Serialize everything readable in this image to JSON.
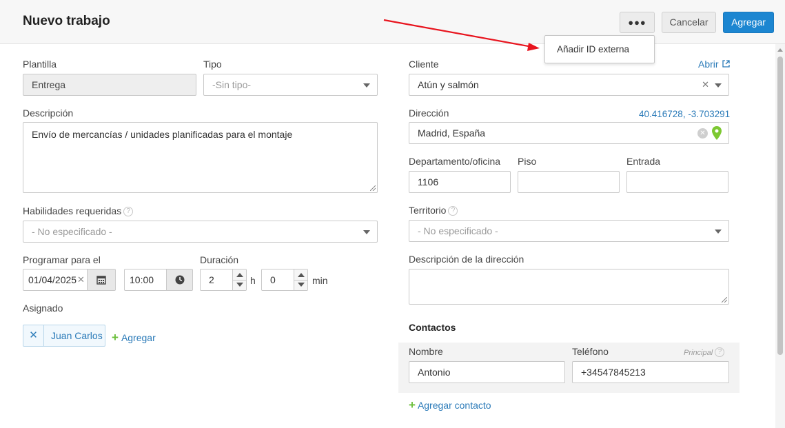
{
  "header": {
    "title": "Nuevo trabajo",
    "more_label": "●●●",
    "cancel_label": "Cancelar",
    "add_label": "Agregar"
  },
  "more_menu": {
    "items": [
      {
        "label": "Añadir ID externa"
      }
    ]
  },
  "form": {
    "plantilla": {
      "label": "Plantilla",
      "value": "Entrega"
    },
    "tipo": {
      "label": "Tipo",
      "placeholder": "-Sin tipo-"
    },
    "descripcion": {
      "label": "Descripción",
      "value": "Envío de mercancías / unidades planificadas para el montaje"
    },
    "habilidades": {
      "label": "Habilidades requeridas",
      "placeholder": "- No especificado -"
    },
    "programar": {
      "label": "Programar para el",
      "date": "01/04/2025",
      "time": "10:00"
    },
    "duracion": {
      "label": "Duración",
      "hours": "2",
      "hours_unit": "h",
      "minutes": "0",
      "minutes_unit": "min"
    },
    "asignado": {
      "label": "Asignado",
      "assignee": "Juan Carlos",
      "add_label": "Agregar"
    },
    "cliente": {
      "label": "Cliente",
      "value": "Atún y salmón",
      "open_label": "Abrir"
    },
    "direccion": {
      "label": "Dirección",
      "value": "Madrid, España",
      "coordinates": "40.416728, -3.703291"
    },
    "departamento": {
      "label": "Departamento/oficina",
      "value": "1106"
    },
    "piso": {
      "label": "Piso",
      "value": ""
    },
    "entrada": {
      "label": "Entrada",
      "value": ""
    },
    "territorio": {
      "label": "Territorio",
      "placeholder": "- No especificado -"
    },
    "descripcion_direccion": {
      "label": "Descripción de la dirección",
      "value": ""
    }
  },
  "contacts": {
    "title": "Contactos",
    "name_label": "Nombre",
    "phone_label": "Teléfono",
    "principal_label": "Principal",
    "name_value": "Antonio",
    "phone_value": "+34547845213",
    "add_label": "Agregar contacto"
  },
  "colors": {
    "primary": "#1c86d1",
    "link": "#2a7ab8",
    "annotation_arrow": "#e8141e",
    "map_pin": "#7dc832"
  }
}
